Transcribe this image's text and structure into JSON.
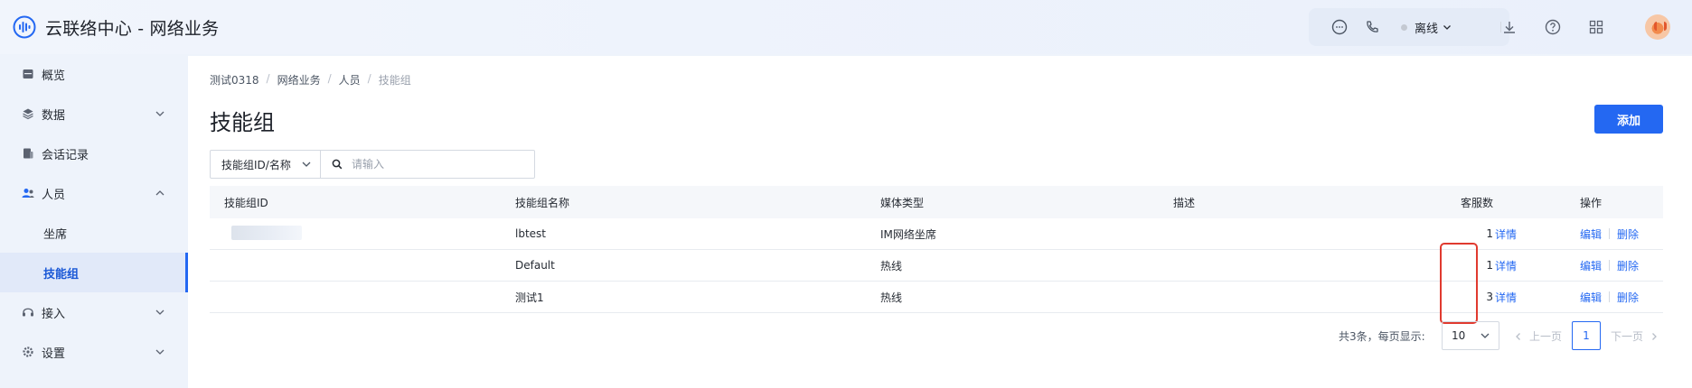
{
  "header": {
    "app_title": "云联络中心 - 网络业务",
    "status_label": "离线",
    "status_color": "#c4c9d2",
    "icons": [
      "chat-icon",
      "phone-icon",
      "download-icon",
      "help-icon",
      "apps-grid-icon"
    ]
  },
  "sidebar": {
    "items": [
      {
        "label": "概览",
        "icon": "overview-icon"
      },
      {
        "label": "数据",
        "icon": "data-icon"
      },
      {
        "label": "会话记录",
        "icon": "session-record-icon"
      },
      {
        "label": "人员",
        "icon": "people-icon"
      },
      {
        "label": "坐席"
      },
      {
        "label": "技能组"
      },
      {
        "label": "接入",
        "icon": "headset-icon"
      },
      {
        "label": "设置",
        "icon": "settings-icon"
      }
    ],
    "active": "技能组"
  },
  "breadcrumb": [
    "测试0318",
    "网络业务",
    "人员",
    "技能组"
  ],
  "page": {
    "title": "技能组",
    "add_label": "添加"
  },
  "filter": {
    "field_select": "技能组ID/名称",
    "search_placeholder": "请输入"
  },
  "table": {
    "columns": [
      "技能组ID",
      "技能组名称",
      "媒体类型",
      "描述",
      "客服数",
      "操作"
    ],
    "rows": [
      {
        "name": "lbtest",
        "media": "IM网络坐席",
        "desc": "",
        "count": "1",
        "detail": "详情",
        "edit": "编辑",
        "delete": "删除"
      },
      {
        "name": "Default",
        "media": "热线",
        "desc": "",
        "count": "1",
        "detail": "详情",
        "edit": "编辑",
        "delete": "删除"
      },
      {
        "name": "测试1",
        "media": "热线",
        "desc": "",
        "count": "3",
        "detail": "详情",
        "edit": "编辑",
        "delete": "删除"
      }
    ]
  },
  "pagination": {
    "total_text": "共3条，每页显示:",
    "page_size": "10",
    "prev_label": "上一页",
    "current_page": "1",
    "next_label": "下一页"
  },
  "colors": {
    "primary": "#2468f2",
    "highlight": "#e03a2f"
  }
}
